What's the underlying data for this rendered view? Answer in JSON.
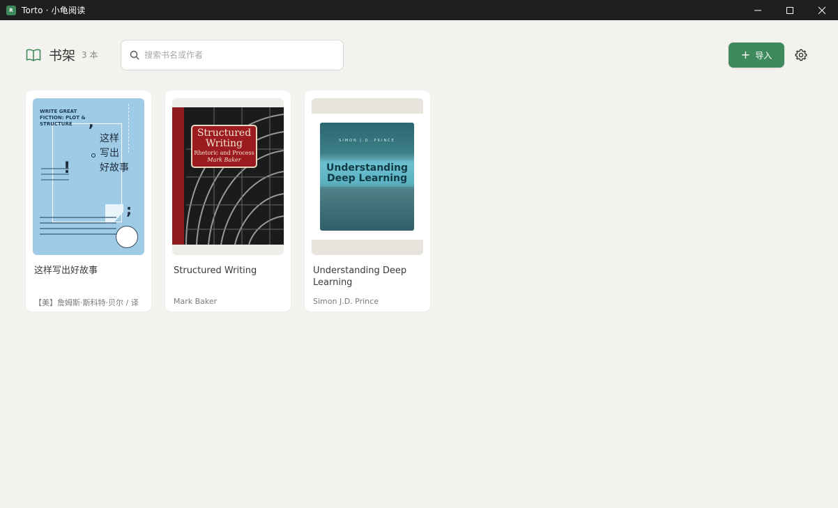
{
  "window": {
    "title": "Torto · 小龟阅读",
    "icon_text": "R"
  },
  "header": {
    "title": "书架",
    "count": "3 本",
    "search_placeholder": "搜索书名或作者",
    "import_label": "导入",
    "import_icon": "+"
  },
  "books": [
    {
      "title": "这样写出好故事",
      "author": "【美】詹姆斯·斯科特·贝尔 / 译",
      "cover": {
        "en_title": "WRITE GREAT FICTION: PLOT & STRUCTURE",
        "zh_title": "这样写出好故事"
      }
    },
    {
      "title": "Structured Writing",
      "author": "Mark Baker",
      "cover": {
        "line1": "Structured",
        "line2": "Writing",
        "subtitle": "Rhetoric and Process",
        "author": "Mark Baker"
      }
    },
    {
      "title": "Understanding Deep Learning",
      "author": "Simon J.D. Prince",
      "cover": {
        "author": "SIMON J.D. PRINCE",
        "title": "Understanding Deep Learning"
      }
    }
  ],
  "colors": {
    "accent": "#3f8a5c",
    "background": "#f3f2ee",
    "titlebar": "#1f1f1f"
  }
}
